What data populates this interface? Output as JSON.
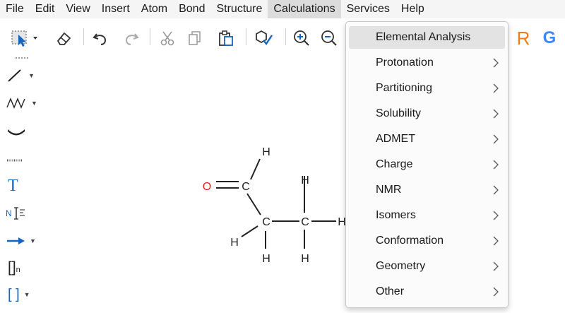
{
  "menubar": {
    "items": [
      "File",
      "Edit",
      "View",
      "Insert",
      "Atom",
      "Bond",
      "Structure",
      "Calculations",
      "Services",
      "Help"
    ],
    "active": "Calculations"
  },
  "toolbar": {
    "tools": [
      "select-rectangle-icon",
      "eraser-icon",
      "undo-icon",
      "redo-icon",
      "cut-icon",
      "copy-icon",
      "paste-icon",
      "clean-structure-icon",
      "zoom-in-icon",
      "zoom-out-icon"
    ],
    "right_icons": [
      "r-service-icon",
      "google-search-icon"
    ],
    "r_letter": "R",
    "g_letter": "G",
    "r_color": "#f07b17",
    "g_color": "#4285f4"
  },
  "leftbar": {
    "tools": [
      "single-bond-icon",
      "chain-icon",
      "ring-icon",
      "dotted-line-icon",
      "text-icon",
      "name-to-structure-icon",
      "reaction-arrow-icon",
      "sgroup-bracket-icon",
      "bracket-icon"
    ],
    "text_tool_label": "T",
    "name_tool_label": "N",
    "sgroup_label": "[]",
    "sgroup_subscript": "n",
    "bracket_label": "[ ]",
    "accent_color": "#1565c0"
  },
  "molecule": {
    "atoms": {
      "oxygen": "O",
      "carbonyl_carbon": "C",
      "alpha_carbon": "C",
      "beta_carbon": "C",
      "h_aldehyde": "H",
      "h_alpha_left": "H",
      "h_alpha_bottom": "H",
      "h_beta_top": "H",
      "h_beta_bottom": "H",
      "h_beta_right": "H"
    },
    "oxygen_color": "#e02020"
  },
  "dropdown": {
    "items": [
      {
        "label": "Elemental Analysis",
        "submenu": false,
        "highlighted": true
      },
      {
        "label": "Protonation",
        "submenu": true
      },
      {
        "label": "Partitioning",
        "submenu": true
      },
      {
        "label": "Solubility",
        "submenu": true
      },
      {
        "label": "ADMET",
        "submenu": true
      },
      {
        "label": "Charge",
        "submenu": true
      },
      {
        "label": "NMR",
        "submenu": true
      },
      {
        "label": "Isomers",
        "submenu": true
      },
      {
        "label": "Conformation",
        "submenu": true
      },
      {
        "label": "Geometry",
        "submenu": true
      },
      {
        "label": "Other",
        "submenu": true
      }
    ]
  }
}
